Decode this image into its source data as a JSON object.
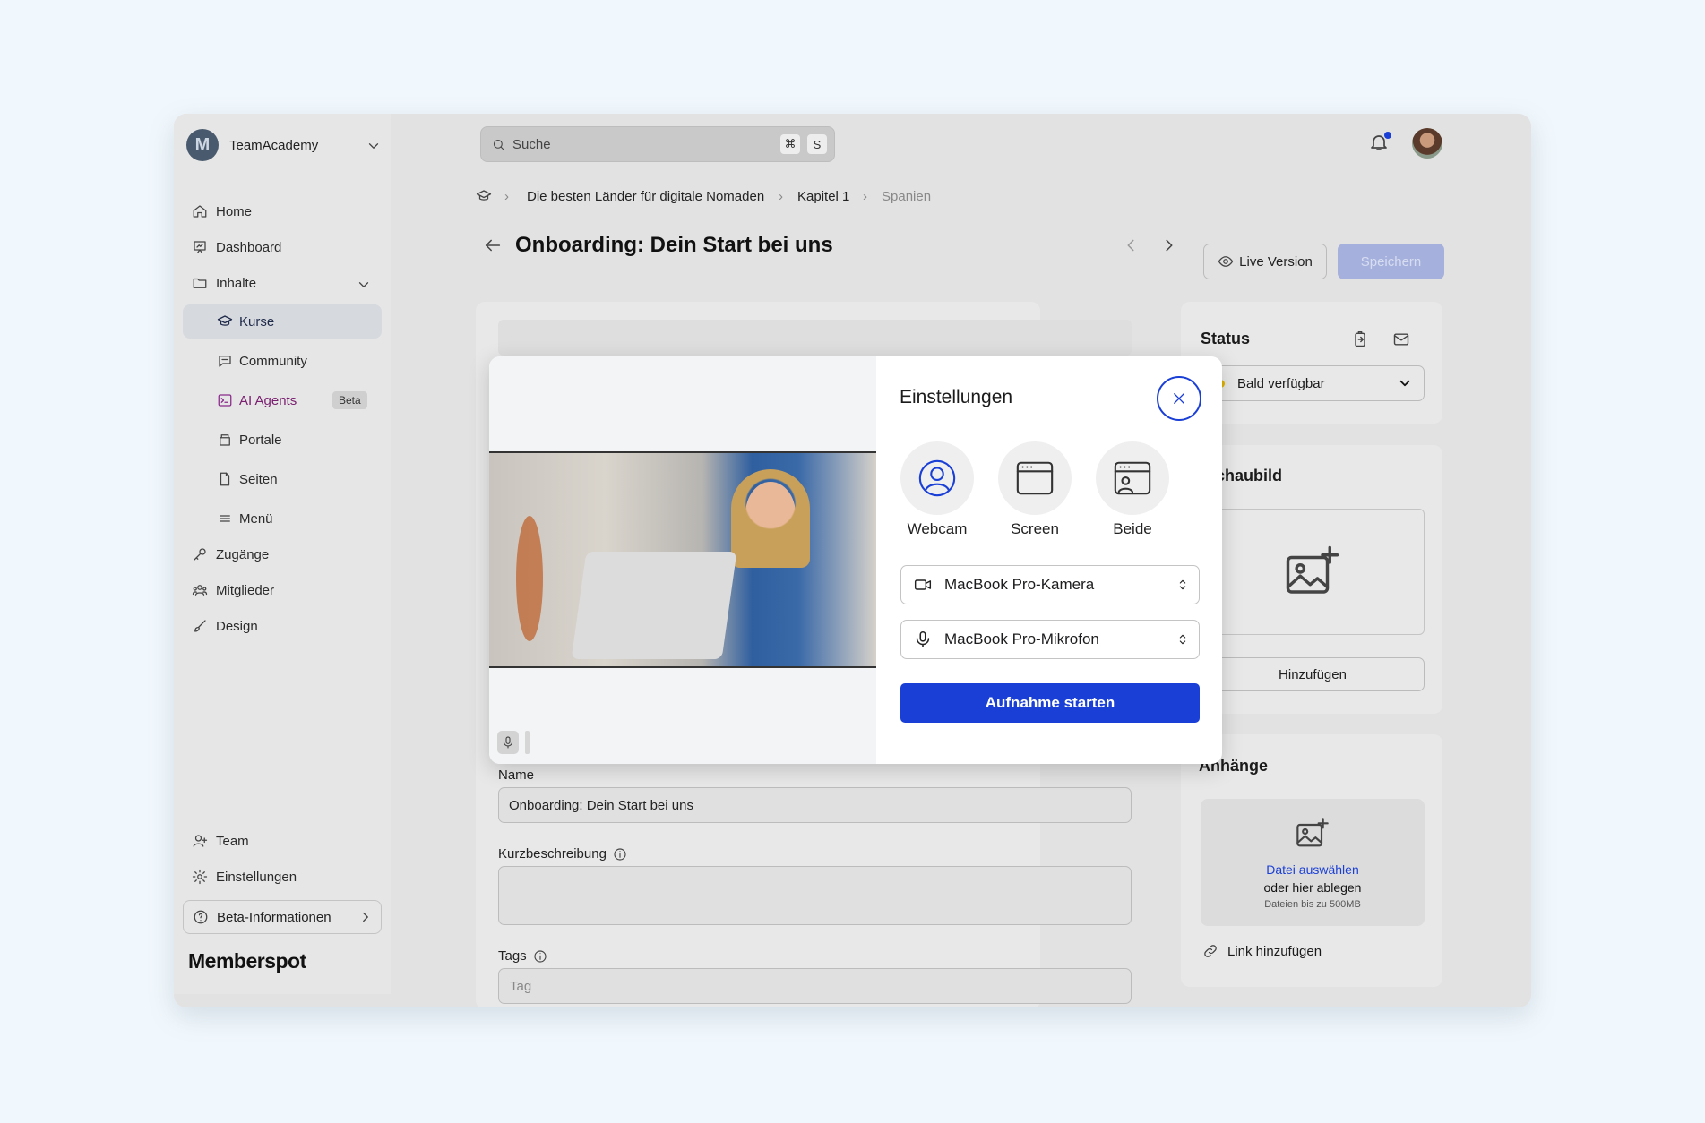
{
  "app": {
    "workspace": "TeamAcademy",
    "workspace_initial": "M",
    "brand": "Memberspot"
  },
  "sidebar": {
    "items": [
      {
        "label": "Home",
        "icon": "home-icon"
      },
      {
        "label": "Dashboard",
        "icon": "dashboard-icon"
      },
      {
        "label": "Inhalte",
        "icon": "folder-icon"
      }
    ],
    "sub_items": [
      {
        "label": "Kurse",
        "icon": "graduation-cap-icon",
        "active": true
      },
      {
        "label": "Community",
        "icon": "chat-icon"
      },
      {
        "label": "AI Agents",
        "icon": "terminal-icon",
        "badge": "Beta"
      },
      {
        "label": "Portale",
        "icon": "portal-icon"
      },
      {
        "label": "Seiten",
        "icon": "page-icon"
      },
      {
        "label": "Menü",
        "icon": "menu-icon"
      }
    ],
    "items2": [
      {
        "label": "Zugänge",
        "icon": "key-icon"
      },
      {
        "label": "Mitglieder",
        "icon": "members-icon"
      },
      {
        "label": "Design",
        "icon": "brush-icon"
      }
    ],
    "bottom": [
      {
        "label": "Team",
        "icon": "user-plus-icon"
      },
      {
        "label": "Einstellungen",
        "icon": "gear-icon"
      }
    ],
    "beta_info": "Beta-Informationen"
  },
  "search": {
    "placeholder": "Suche",
    "shortcut_key1": "⌘",
    "shortcut_key2": "S"
  },
  "breadcrumb": [
    "Die besten Länder für digitale Nomaden",
    "Kapitel 1",
    "Spanien"
  ],
  "page": {
    "title": "Onboarding: Dein Start bei uns",
    "live_version": "Live Version",
    "save": "Speichern"
  },
  "status_card": {
    "title": "Status",
    "value": "Bald verfügbar",
    "dot_color": "#e3b400"
  },
  "preview_card": {
    "title": "rschaubild",
    "add": "Hinzufügen"
  },
  "attachments": {
    "title": "Anhänge",
    "choose": "Datei auswählen",
    "drop": "oder hier ablegen",
    "limit": "Dateien bis zu 500MB",
    "link": "Link hinzufügen"
  },
  "form": {
    "name_label": "Name",
    "name_value": "Onboarding: Dein Start bei uns",
    "desc_label": "Kurzbeschreibung",
    "tags_label": "Tags",
    "tags_placeholder": "Tag"
  },
  "modal": {
    "title": "Einstellungen",
    "sources": [
      {
        "label": "Webcam",
        "icon": "webcam-icon",
        "selected": true
      },
      {
        "label": "Screen",
        "icon": "screen-icon"
      },
      {
        "label": "Beide",
        "icon": "screen-and-webcam-icon"
      }
    ],
    "camera": "MacBook Pro-Kamera",
    "microphone": "MacBook Pro-Mikrofon",
    "start": "Aufnahme starten",
    "accent": "#1a3fd6"
  }
}
